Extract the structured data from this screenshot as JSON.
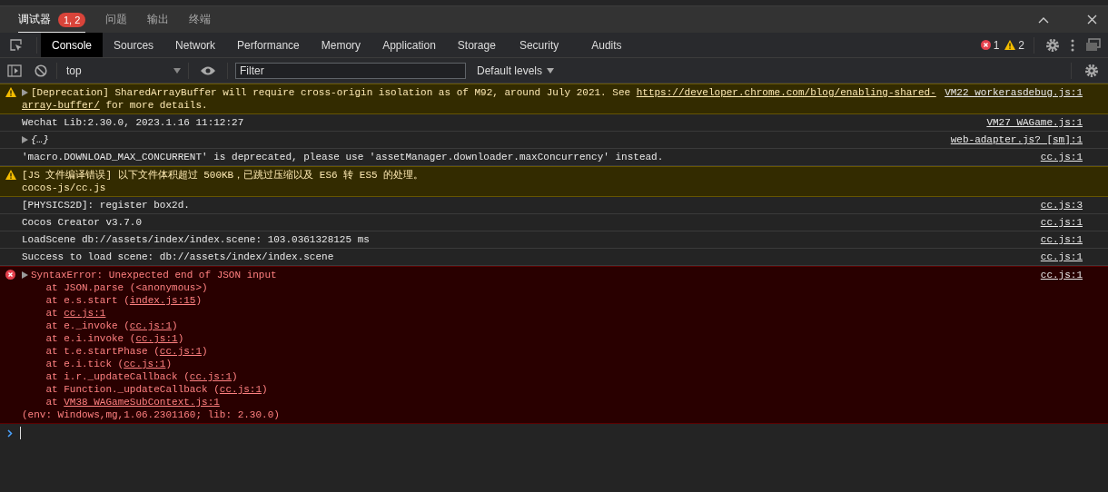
{
  "panel_tabs": [
    {
      "label": "调试器",
      "selected": true,
      "badge": "1, 2"
    },
    {
      "label": "问题",
      "selected": false
    },
    {
      "label": "输出",
      "selected": false
    },
    {
      "label": "终端",
      "selected": false
    }
  ],
  "devtools_tabs": [
    {
      "label": "Console",
      "selected": true
    },
    {
      "label": "Sources",
      "selected": false
    },
    {
      "label": "Network",
      "selected": false
    },
    {
      "label": "Performance",
      "selected": false
    },
    {
      "label": "Memory",
      "selected": false
    },
    {
      "label": "Application",
      "selected": false
    },
    {
      "label": "Storage",
      "selected": false
    },
    {
      "label": "Security",
      "selected": false
    },
    {
      "label": "Audits",
      "selected": false
    }
  ],
  "counts": {
    "errors": "1",
    "warnings": "2"
  },
  "toolbar": {
    "context": "top",
    "filter": {
      "placeholder": "Filter"
    },
    "levels": "Default levels"
  },
  "messages": [
    {
      "kind": "warning",
      "expanded": false,
      "lines": [
        [
          {
            "text": "[Deprecation] SharedArrayBuffer will require cross-origin isolation as of M92, around July 2021. See "
          },
          {
            "link": "https://developer.chrome.com/blog/enabling-shared-"
          }
        ],
        [
          {
            "link": "array-buffer/"
          },
          {
            "text": " for more details."
          }
        ]
      ],
      "source": "VM22 workerasdebug.js:1"
    },
    {
      "kind": "log",
      "lines": [
        [
          {
            "text": "Wechat Lib:2.30.0, 2023.1.16 11:12:27"
          }
        ]
      ],
      "source": "VM27 WAGame.js:1"
    },
    {
      "kind": "object",
      "expanded": false,
      "lines": [
        [
          {
            "text": "{…}"
          }
        ]
      ],
      "source": "web-adapter.js? [sm]:1"
    },
    {
      "kind": "log",
      "lines": [
        [
          {
            "text": "'macro.DOWNLOAD_MAX_CONCURRENT' is deprecated, please use 'assetManager.downloader.maxConcurrency' instead."
          }
        ]
      ],
      "source": "cc.js:1"
    },
    {
      "kind": "warning",
      "lines": [
        [
          {
            "text": "[JS 文件编译错误] 以下文件体积超过 500KB，已跳过压缩以及 ES6 转 ES5 的处理。"
          }
        ],
        [
          {
            "text": "cocos-js/cc.js"
          }
        ]
      ]
    },
    {
      "kind": "log",
      "lines": [
        [
          {
            "text": "[PHYSICS2D]: register box2d."
          }
        ]
      ],
      "source": "cc.js:3"
    },
    {
      "kind": "log",
      "lines": [
        [
          {
            "text": "Cocos Creator v3.7.0"
          }
        ]
      ],
      "source": "cc.js:1"
    },
    {
      "kind": "log",
      "lines": [
        [
          {
            "text": "LoadScene db://assets/index/index.scene: 103.0361328125 ms"
          }
        ]
      ],
      "source": "cc.js:1"
    },
    {
      "kind": "log",
      "lines": [
        [
          {
            "text": "Success to load scene: db://assets/index/index.scene"
          }
        ]
      ],
      "source": "cc.js:1"
    },
    {
      "kind": "error",
      "expanded": false,
      "lines": [
        [
          {
            "text": "SyntaxError: Unexpected end of JSON input"
          }
        ],
        [
          {
            "text": "    at JSON.parse (<anonymous>)"
          }
        ],
        [
          {
            "text": "    at e.s.start ("
          },
          {
            "link": "index.js:15"
          },
          {
            "text": ")"
          }
        ],
        [
          {
            "text": "    at "
          },
          {
            "link": "cc.js:1"
          }
        ],
        [
          {
            "text": "    at e._invoke ("
          },
          {
            "link": "cc.js:1"
          },
          {
            "text": ")"
          }
        ],
        [
          {
            "text": "    at e.i.invoke ("
          },
          {
            "link": "cc.js:1"
          },
          {
            "text": ")"
          }
        ],
        [
          {
            "text": "    at t.e.startPhase ("
          },
          {
            "link": "cc.js:1"
          },
          {
            "text": ")"
          }
        ],
        [
          {
            "text": "    at e.i.tick ("
          },
          {
            "link": "cc.js:1"
          },
          {
            "text": ")"
          }
        ],
        [
          {
            "text": "    at i.r._updateCallback ("
          },
          {
            "link": "cc.js:1"
          },
          {
            "text": ")"
          }
        ],
        [
          {
            "text": "    at Function._updateCallback ("
          },
          {
            "link": "cc.js:1"
          },
          {
            "text": ")"
          }
        ],
        [
          {
            "text": "    at "
          },
          {
            "link": "VM38 WAGameSubContext.js:1"
          }
        ],
        [
          {
            "text": "(env: Windows,mg,1.06.2301160; lib: 2.30.0)"
          }
        ]
      ],
      "source": "cc.js:1"
    }
  ]
}
